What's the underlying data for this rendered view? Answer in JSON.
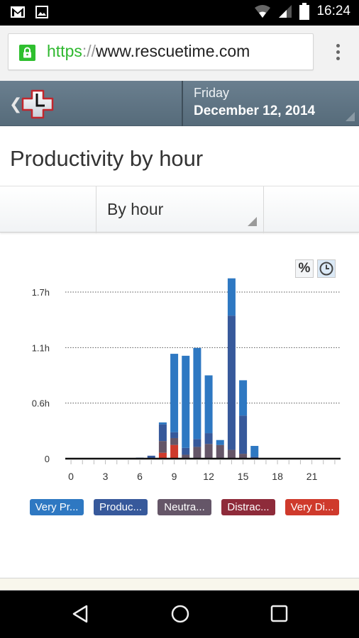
{
  "status_bar": {
    "time": "16:24",
    "left_icons": [
      "gmail-icon",
      "image-icon"
    ],
    "right_icons": [
      "wifi-icon",
      "signal-icon",
      "battery-icon"
    ]
  },
  "browser": {
    "url_scheme": "https",
    "url_separator": "://",
    "url_host": "www.rescuetime.com",
    "secure": true
  },
  "header": {
    "day": "Friday",
    "date": "December 12, 2014"
  },
  "page": {
    "title": "Productivity by hour",
    "view_select": "By hour"
  },
  "chart_buttons": {
    "percent_label": "%",
    "time_icon": "clock-icon"
  },
  "legend": [
    {
      "label": "Very Pr...",
      "full": "Very Productive",
      "color": "#2e78c2"
    },
    {
      "label": "Produc...",
      "full": "Productive",
      "color": "#37599b"
    },
    {
      "label": "Neutra...",
      "full": "Neutral",
      "color": "#655668"
    },
    {
      "label": "Distrac...",
      "full": "Distracting",
      "color": "#8e2b3a"
    },
    {
      "label": "Very Di...",
      "full": "Very Distracting",
      "color": "#cf3a2c"
    }
  ],
  "chart_data": {
    "type": "bar",
    "stacked": true,
    "title": "Productivity by hour",
    "xlabel": "",
    "ylabel": "",
    "categories": [
      0,
      1,
      2,
      3,
      4,
      5,
      6,
      7,
      8,
      9,
      10,
      11,
      12,
      13,
      14,
      15,
      16,
      17,
      18,
      19,
      20,
      21,
      22,
      23
    ],
    "x_tick_labels": [
      "0",
      "3",
      "6",
      "9",
      "12",
      "15",
      "18",
      "21"
    ],
    "y_tick_labels": [
      "0",
      "0.6h",
      "1.1h",
      "1.7h"
    ],
    "y_ticks": [
      0,
      0.567,
      1.133,
      1.7
    ],
    "ylim": [
      0,
      1.9
    ],
    "grid": true,
    "legend_position": "bottom",
    "series": [
      {
        "name": "Very Distracting",
        "color": "#cf3a2c",
        "values": [
          0,
          0,
          0,
          0,
          0,
          0,
          0,
          0,
          0.06,
          0.14,
          0,
          0,
          0,
          0,
          0,
          0,
          0,
          0,
          0,
          0,
          0,
          0,
          0,
          0
        ]
      },
      {
        "name": "Distracting",
        "color": "#8e2b3a",
        "values": [
          0,
          0,
          0,
          0,
          0,
          0,
          0,
          0,
          0,
          0,
          0,
          0,
          0,
          0,
          0,
          0,
          0,
          0,
          0,
          0,
          0,
          0,
          0,
          0
        ]
      },
      {
        "name": "Neutral",
        "color": "#655668",
        "values": [
          0,
          0,
          0,
          0,
          0,
          0,
          0,
          0,
          0.12,
          0.07,
          0.04,
          0.12,
          0.15,
          0.14,
          0.09,
          0.05,
          0,
          0,
          0,
          0,
          0,
          0,
          0,
          0
        ]
      },
      {
        "name": "Productive",
        "color": "#37599b",
        "values": [
          0,
          0,
          0,
          0,
          0,
          0,
          0.01,
          0.03,
          0.17,
          0.06,
          0.07,
          0.08,
          0.11,
          0,
          1.37,
          0.39,
          0.02,
          0,
          0,
          0,
          0,
          0,
          0,
          0
        ]
      },
      {
        "name": "Very Productive",
        "color": "#2e78c2",
        "values": [
          0,
          0,
          0,
          0,
          0,
          0,
          0,
          0,
          0.02,
          0.8,
          0.94,
          0.93,
          0.59,
          0.05,
          0.38,
          0.36,
          0.11,
          0,
          0,
          0,
          0,
          0,
          0,
          0
        ]
      }
    ]
  }
}
